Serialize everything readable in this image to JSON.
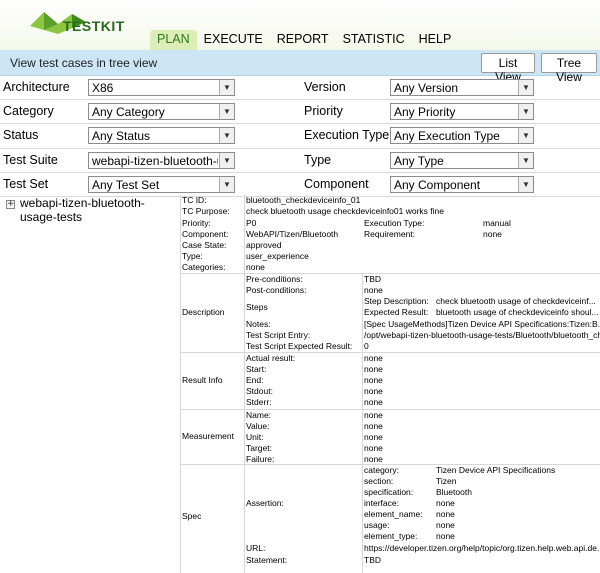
{
  "brand": {
    "name": "TESTKIT"
  },
  "nav": {
    "items": [
      "PLAN",
      "EXECUTE",
      "REPORT",
      "STATISTIC",
      "HELP"
    ],
    "active": "PLAN"
  },
  "toolbar": {
    "label": "View test cases in tree view",
    "list_view": "List View",
    "tree_view": "Tree View"
  },
  "filters": [
    {
      "label": "Architecture",
      "value": "X86",
      "label2": "Version",
      "value2": "Any Version"
    },
    {
      "label": "Category",
      "value": "Any Category",
      "label2": "Priority",
      "value2": "Any Priority"
    },
    {
      "label": "Status",
      "value": "Any Status",
      "label2": "Execution Type",
      "value2": "Any Execution Type"
    },
    {
      "label": "Test Suite",
      "value": "webapi-tizen-bluetooth-us",
      "label2": "Type",
      "value2": "Any Type"
    },
    {
      "label": "Test Set",
      "value": "Any Test Set",
      "label2": "Component",
      "value2": "Any Component"
    }
  ],
  "tree": {
    "toggle": "+",
    "item": "webapi-tizen-bluetooth-usage-tests"
  },
  "detail": {
    "tc_id_label": "TC ID:",
    "tc_id": "bluetooth_checkdeviceinfo_01",
    "purpose_label": "TC Purpose:",
    "purpose": "check bluetooth usage checkdeviceinfo01 works fine",
    "priority_label": "Priority:",
    "priority": "P0",
    "exec_type_label": "Execution Type:",
    "exec_type": "manual",
    "component_label": "Component:",
    "component": "WebAPI/Tizen/Bluetooth",
    "requirement_label": "Requirement:",
    "requirement": "none",
    "case_state_label": "Case State:",
    "case_state": "approved",
    "type_label": "Type:",
    "type": "user_experience",
    "categories_label": "Categories:",
    "categories": "none",
    "description": {
      "section": "Description",
      "pre_label": "Pre-conditions:",
      "pre": "TBD",
      "post_label": "Post-conditions:",
      "post": "none",
      "steps_label": "Steps",
      "step_desc_label": "Step Description:",
      "step_desc": "check bluetooth usage of checkdeviceinf...",
      "expected_label": "Expected Result:",
      "expected": "bluetooth usage of checkdeviceinfo shoul...",
      "notes_label": "Notes:",
      "notes": "[Spec UsageMethods]Tizen Device API Specifications:Tizen:B...",
      "entry_label": "Test Script Entry:",
      "entry": "/opt/webapi-tizen-bluetooth-usage-tests/Bluetooth/bluetooth_ch...",
      "expres_label": "Test Script Expected Result:",
      "expres": "0"
    },
    "result": {
      "section": "Result Info",
      "actual_label": "Actual result:",
      "actual": "none",
      "start_label": "Start:",
      "start": "none",
      "end_label": "End:",
      "end": "none",
      "stdout_label": "Stdout:",
      "stdout": "none",
      "stderr_label": "Stderr:",
      "stderr": "none"
    },
    "measure": {
      "section": "Measurement",
      "name_label": "Name:",
      "name": "none",
      "value_label": "Value:",
      "value": "none",
      "unit_label": "Unit:",
      "unit": "none",
      "target_label": "Target:",
      "target": "none",
      "failure_label": "Failure:",
      "failure": "none"
    },
    "spec": {
      "section": "Spec",
      "assertion_label": "Assertion:",
      "category_label": "category:",
      "category": "Tizen Device API Specifications",
      "sect_label": "section:",
      "sect": "Tizen",
      "specification_label": "specification:",
      "specification": "Bluetooth",
      "interface_label": "interface:",
      "interface": "none",
      "element_name_label": "element_name:",
      "element_name": "none",
      "usage_label": "usage:",
      "usage": "none",
      "element_type_label": "element_type:",
      "element_type": "none",
      "url_label": "URL:",
      "url": "https://developer.tizen.org/help/topic/org.tizen.help.web.api.de...",
      "statement_label": "Statement:",
      "statement": "TBD"
    }
  },
  "colors": {
    "accent_green": "#2c7a1d",
    "toolbar_bg": "#cce6f5",
    "nav_active_bg": "#dcedb7"
  }
}
